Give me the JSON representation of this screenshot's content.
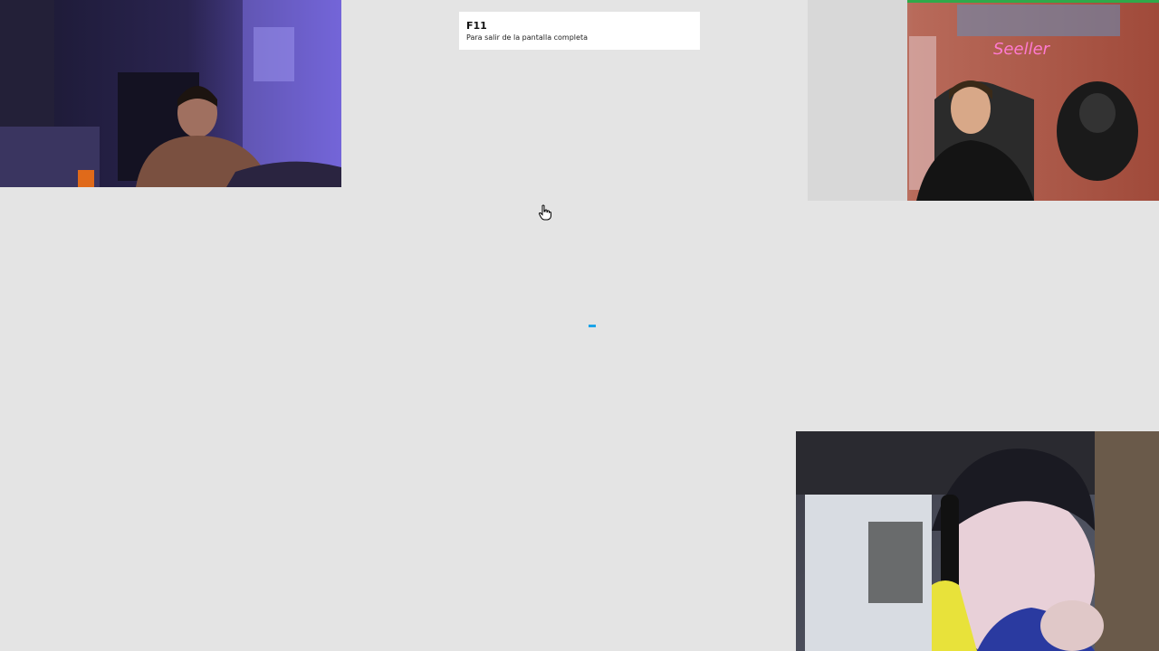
{
  "fullscreen_hint": {
    "key": "F11",
    "message": "Para salir de la pantalla completa"
  },
  "cursor": {
    "icon": "hand-pointer-icon"
  },
  "loading": {
    "color": "#1aa3e8"
  },
  "webcams": [
    {
      "name": "webcam-top-left",
      "tint": "#3a2f8f"
    },
    {
      "name": "webcam-top-right",
      "tint": "#9a3a2c"
    },
    {
      "name": "webcam-bottom-right",
      "tint": "#2f3a52"
    }
  ]
}
